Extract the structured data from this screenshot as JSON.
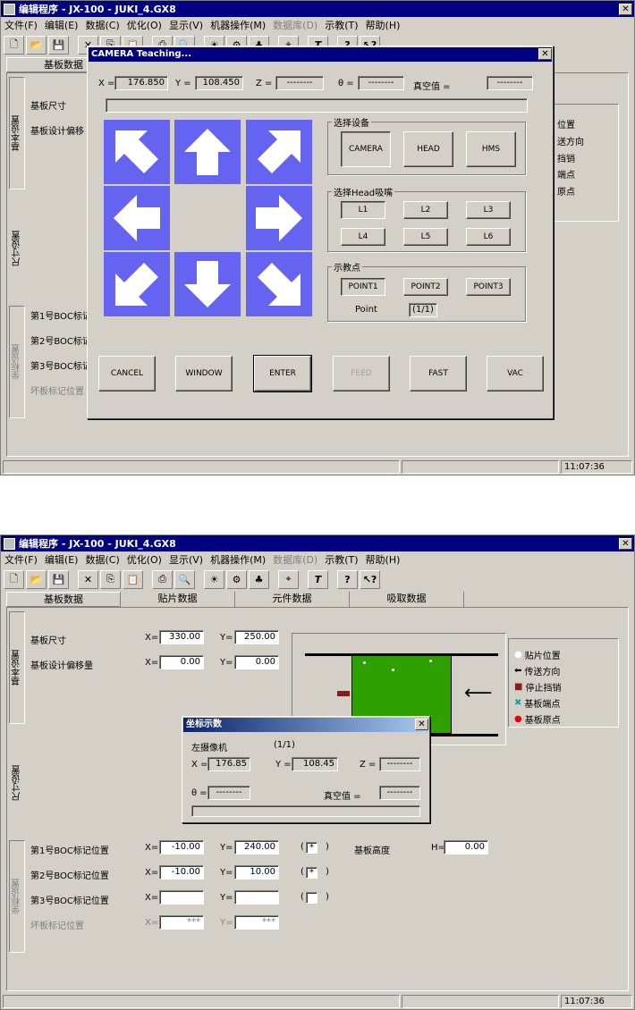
{
  "app_title": "编辑程序 - JX-100 - JUKI_4.GX8",
  "menu": [
    "文件(F)",
    "编辑(E)",
    "数据(C)",
    "优化(O)",
    "显示(V)",
    "机器操作(M)",
    "数据库(D)",
    "示教(T)",
    "帮助(H)"
  ],
  "toolbar_icons": [
    "new-icon",
    "open-icon",
    "save-icon",
    "cut-icon",
    "copy-icon",
    "paste-icon",
    "print-icon",
    "find-icon",
    "light-icon",
    "robot-icon",
    "component-icon",
    "teach-icon",
    "text-icon",
    "help-icon",
    "context-help-icon"
  ],
  "tabs": [
    "基板数据",
    "贴片数据",
    "元件数据",
    "吸取数据"
  ],
  "side_tabs": {
    "basic": "基本设置",
    "size": "尺寸设置",
    "mark": "坐标设置"
  },
  "board": {
    "size_label": "基板尺寸",
    "offset_label": "基板设计偏移量",
    "x_label": "X=",
    "y_label": "Y=",
    "size_x": "330.00",
    "size_y": "250.00",
    "offset_x": "0.00",
    "offset_y": "0.00",
    "height_label": "基板高度",
    "height_h_label": "H=",
    "height": "0.00"
  },
  "legend": {
    "items": [
      "贴片位置",
      "传送方向",
      "停止挡销",
      "基板端点",
      "基板原点"
    ],
    "top_partial": [
      "位置",
      "送方向",
      "挡销",
      "端点",
      "原点"
    ]
  },
  "marks": [
    {
      "label": "第1号BOC标记位置",
      "x": "-10.00",
      "y": "240.00",
      "checked": "*"
    },
    {
      "label": "第2号BOC标记位置",
      "x": "-10.00",
      "y": "10.00",
      "checked": "*"
    },
    {
      "label": "第3号BOC标记位置",
      "x": "",
      "y": "",
      "checked": ""
    },
    {
      "label": "坏板标记位置",
      "x": "***",
      "y": "***",
      "checked": null
    }
  ],
  "marks_top": [
    "第1号BOC标记",
    "第2号BOC标记",
    "第3号BOC标记",
    "坏板标记位置"
  ],
  "board_size_short": "基板尺寸",
  "board_offset_short": "基板设计偏移",
  "status_time": "11:07:36",
  "camera_dialog": {
    "title": "CAMERA Teaching...",
    "x_label": "X =",
    "y_label": "Y =",
    "z_label": "Z =",
    "theta_label": "θ =",
    "vac_label": "真空值 =",
    "x": "176.850",
    "y": "108.450",
    "z": "--------",
    "theta": "--------",
    "vac": "--------",
    "device_group": "选择设备",
    "devices": [
      "CAMERA",
      "HEAD",
      "HMS"
    ],
    "nozzle_group": "选择Head吸嘴",
    "nozzles": [
      "L1",
      "L2",
      "L3",
      "L4",
      "L5",
      "L6"
    ],
    "teach_group": "示教点",
    "points": [
      "POINT1",
      "POINT2",
      "POINT3"
    ],
    "point_label": "Point",
    "point_value": "(1/1)",
    "buttons": [
      "CANCEL",
      "WINDOW",
      "ENTER",
      "FEED",
      "FAST",
      "VAC"
    ]
  },
  "coord_dialog": {
    "title": "坐标示数",
    "device": "左摄像机",
    "count": "(1/1)",
    "x_label": "X =",
    "y_label": "Y =",
    "z_label": "Z =",
    "theta_label": "θ =",
    "vac_label": "真空值 =",
    "x": "176.85",
    "y": "108.45",
    "z": "--------",
    "theta": "--------",
    "vac": "--------"
  },
  "colors": {
    "title": "#000080",
    "face": "#d4d0c8",
    "arrow_pad": "#6464f0",
    "board_green": "#2ea000"
  }
}
